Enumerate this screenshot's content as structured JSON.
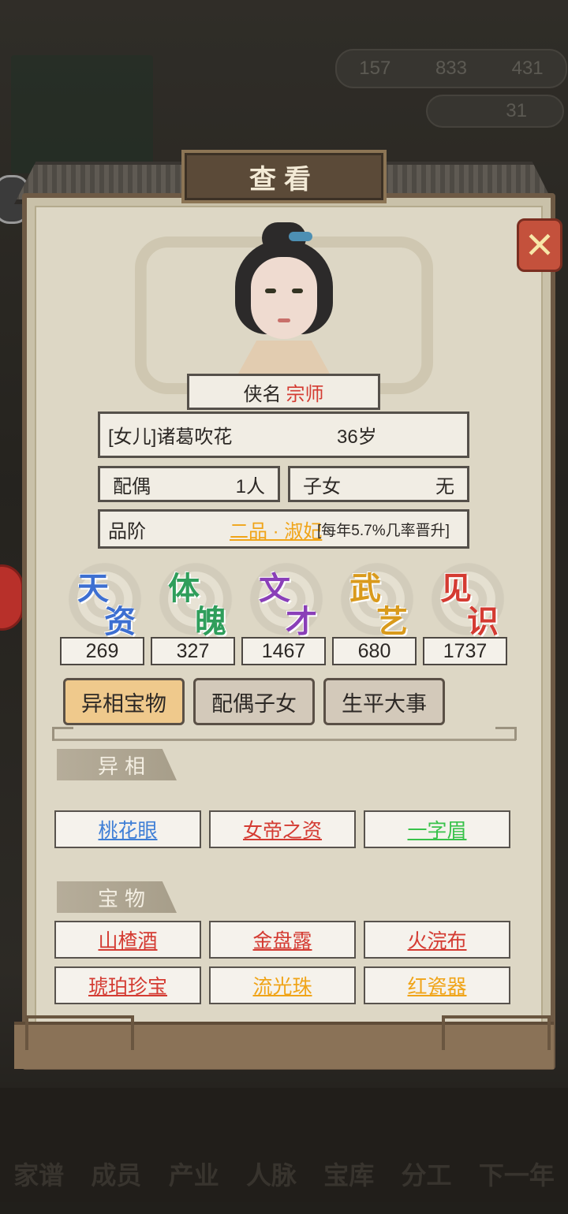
{
  "background": {
    "currency": [
      "157",
      "833",
      "431"
    ],
    "gold_count": "31",
    "nav": [
      "家谱",
      "成员",
      "产业",
      "人脉",
      "宝库",
      "分工",
      "下一年"
    ]
  },
  "dialog": {
    "title": "查看",
    "close_icon": "close-x-icon"
  },
  "character": {
    "title_label": "侠名",
    "title_value": "宗师",
    "name": "[女儿]诸葛吹花",
    "age": "36岁",
    "spouse_label": "配偶",
    "spouse_value": "1人",
    "children_label": "子女",
    "children_value": "无",
    "rank_label": "品阶",
    "rank_value": "二品 · 淑妃",
    "rank_note": "[每年5.7%几率晋升]"
  },
  "attributes": [
    {
      "c1": "天",
      "c2": "资",
      "value": "269",
      "color": "#3d6fd1"
    },
    {
      "c1": "体",
      "c2": "魄",
      "value": "327",
      "color": "#2f9e5b"
    },
    {
      "c1": "文",
      "c2": "才",
      "value": "1467",
      "color": "#8a3fb8"
    },
    {
      "c1": "武",
      "c2": "艺",
      "value": "680",
      "color": "#d99a1c"
    },
    {
      "c1": "见",
      "c2": "识",
      "value": "1737",
      "color": "#d43b32"
    }
  ],
  "tabs": [
    {
      "label": "异相宝物",
      "active": true
    },
    {
      "label": "配偶子女",
      "active": false
    },
    {
      "label": "生平大事",
      "active": false
    }
  ],
  "traits": {
    "header": "异相",
    "items": [
      {
        "label": "桃花眼",
        "color": "#3f7fd6"
      },
      {
        "label": "女帝之资",
        "color": "#d43b32"
      },
      {
        "label": "一字眉",
        "color": "#38c24a"
      }
    ]
  },
  "treasures": {
    "header": "宝物",
    "items": [
      {
        "label": "山楂酒",
        "color": "#d43b32"
      },
      {
        "label": "金盘露",
        "color": "#d43b32"
      },
      {
        "label": "火浣布",
        "color": "#d43b32"
      },
      {
        "label": "琥珀珍宝",
        "color": "#d43b32"
      },
      {
        "label": "流光珠",
        "color": "#f0a418"
      },
      {
        "label": "红瓷器",
        "color": "#f0a418"
      }
    ]
  }
}
